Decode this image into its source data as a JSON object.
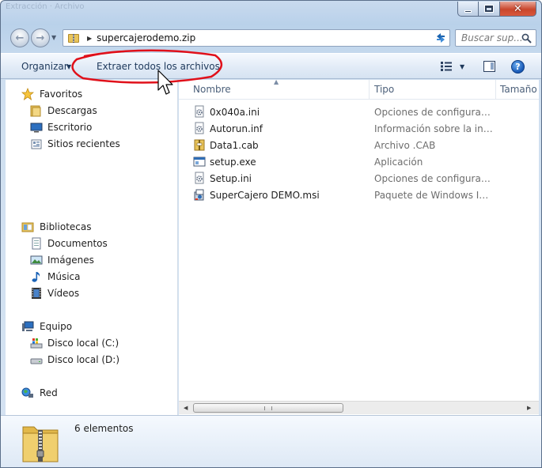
{
  "window": {
    "title_faint": "Extracción  ·  Archivo",
    "controls": {
      "minimize": "minimize",
      "maximize": "maximize",
      "close": "✕"
    }
  },
  "address": {
    "path": "supercajerodemo.zip",
    "search_placeholder": "Buscar sup..."
  },
  "toolbar": {
    "organize_label": "Organizar",
    "extract_label": "Extraer todos los archivos",
    "help_label": "?"
  },
  "nav": {
    "favorites": {
      "label": "Favoritos",
      "items": [
        "Descargas",
        "Escritorio",
        "Sitios recientes"
      ]
    },
    "libraries": {
      "label": "Bibliotecas",
      "items": [
        "Documentos",
        "Imágenes",
        "Música",
        "Vídeos"
      ]
    },
    "computer": {
      "label": "Equipo",
      "items": [
        "Disco local (C:)",
        "Disco local (D:)"
      ]
    },
    "network": {
      "label": "Red"
    }
  },
  "columns": {
    "name": "Nombre",
    "type": "Tipo",
    "size": "Tamaño"
  },
  "files": [
    {
      "name": "0x040a.ini",
      "type": "Opciones de configuración",
      "icon": "ini-file-icon"
    },
    {
      "name": "Autorun.inf",
      "type": "Información sobre la insta...",
      "icon": "inf-file-icon"
    },
    {
      "name": "Data1.cab",
      "type": "Archivo .CAB",
      "icon": "cab-file-icon"
    },
    {
      "name": "setup.exe",
      "type": "Aplicación",
      "icon": "exe-file-icon"
    },
    {
      "name": "Setup.ini",
      "type": "Opciones de configuración",
      "icon": "ini-file-icon"
    },
    {
      "name": "SuperCajero DEMO.msi",
      "type": "Paquete de Windows Inst...",
      "icon": "msi-file-icon"
    }
  ],
  "status": {
    "count": "6 elementos"
  },
  "colors": {
    "annotation": "#e0101a",
    "accent": "#1e395b"
  }
}
